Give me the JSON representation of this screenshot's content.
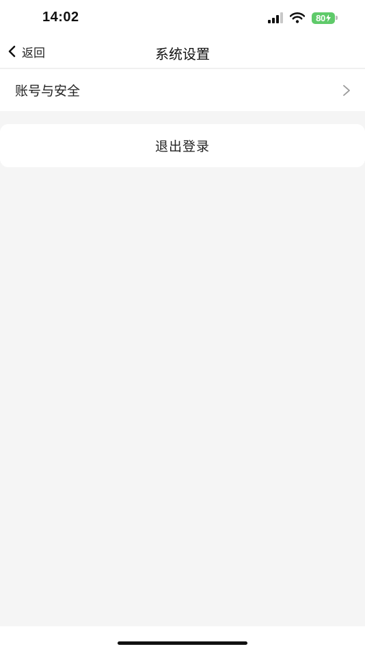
{
  "status_bar": {
    "time": "14:02",
    "battery_percent": "80",
    "icons": [
      "cellular-signal-icon",
      "wifi-icon",
      "battery-charging-icon"
    ]
  },
  "nav": {
    "back_label": "返回",
    "title": "系统设置"
  },
  "settings": {
    "items": [
      {
        "label": "账号与安全",
        "icon": "chevron-right-icon"
      }
    ]
  },
  "logout": {
    "label": "退出登录"
  },
  "colors": {
    "background": "#f5f5f5",
    "card": "#ffffff",
    "battery": "#5fca6a",
    "text": "#222222"
  }
}
